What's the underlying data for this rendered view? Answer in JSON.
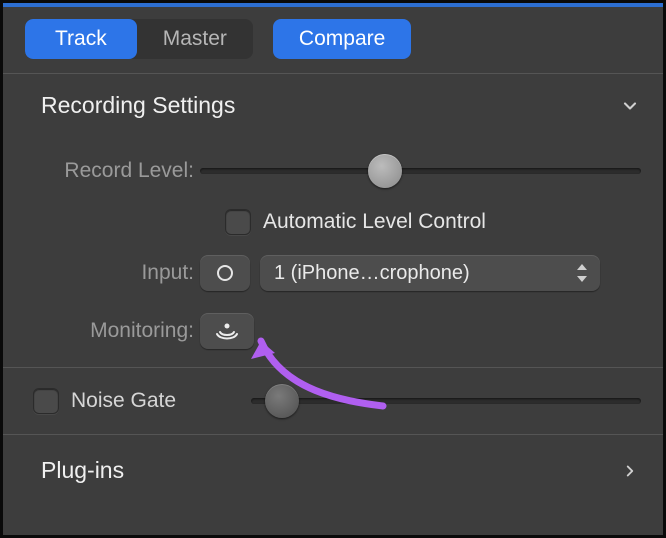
{
  "tabs": {
    "track": "Track",
    "master": "Master",
    "compare": "Compare"
  },
  "recording": {
    "title": "Recording Settings",
    "record_level_label": "Record Level:",
    "record_level_pct": 42,
    "auto_level_label": "Automatic Level Control",
    "auto_level_checked": false,
    "input_label": "Input:",
    "input_mono_icon": "mono-circle",
    "input_selected": "1 (iPhone…crophone)",
    "monitoring_label": "Monitoring:",
    "monitoring_icon": "monitoring-icon"
  },
  "noise_gate": {
    "label": "Noise Gate",
    "checked": false,
    "value_pct": 8
  },
  "plugins": {
    "title": "Plug-ins"
  },
  "annotation": {
    "arrow_color": "#b05ff0"
  }
}
